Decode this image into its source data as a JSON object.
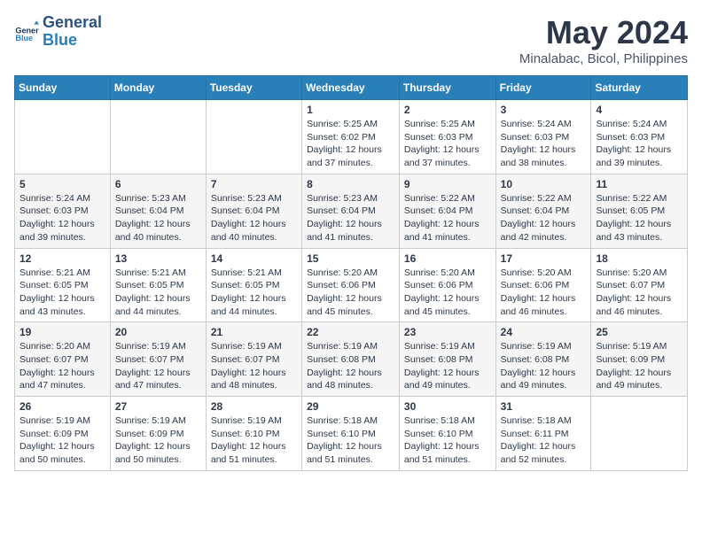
{
  "logo": {
    "text1": "General",
    "text2": "Blue"
  },
  "title": "May 2024",
  "subtitle": "Minalabac, Bicol, Philippines",
  "days_header": [
    "Sunday",
    "Monday",
    "Tuesday",
    "Wednesday",
    "Thursday",
    "Friday",
    "Saturday"
  ],
  "weeks": [
    [
      {
        "day": "",
        "info": ""
      },
      {
        "day": "",
        "info": ""
      },
      {
        "day": "",
        "info": ""
      },
      {
        "day": "1",
        "info": "Sunrise: 5:25 AM\nSunset: 6:02 PM\nDaylight: 12 hours\nand 37 minutes."
      },
      {
        "day": "2",
        "info": "Sunrise: 5:25 AM\nSunset: 6:03 PM\nDaylight: 12 hours\nand 37 minutes."
      },
      {
        "day": "3",
        "info": "Sunrise: 5:24 AM\nSunset: 6:03 PM\nDaylight: 12 hours\nand 38 minutes."
      },
      {
        "day": "4",
        "info": "Sunrise: 5:24 AM\nSunset: 6:03 PM\nDaylight: 12 hours\nand 39 minutes."
      }
    ],
    [
      {
        "day": "5",
        "info": "Sunrise: 5:24 AM\nSunset: 6:03 PM\nDaylight: 12 hours\nand 39 minutes."
      },
      {
        "day": "6",
        "info": "Sunrise: 5:23 AM\nSunset: 6:04 PM\nDaylight: 12 hours\nand 40 minutes."
      },
      {
        "day": "7",
        "info": "Sunrise: 5:23 AM\nSunset: 6:04 PM\nDaylight: 12 hours\nand 40 minutes."
      },
      {
        "day": "8",
        "info": "Sunrise: 5:23 AM\nSunset: 6:04 PM\nDaylight: 12 hours\nand 41 minutes."
      },
      {
        "day": "9",
        "info": "Sunrise: 5:22 AM\nSunset: 6:04 PM\nDaylight: 12 hours\nand 41 minutes."
      },
      {
        "day": "10",
        "info": "Sunrise: 5:22 AM\nSunset: 6:04 PM\nDaylight: 12 hours\nand 42 minutes."
      },
      {
        "day": "11",
        "info": "Sunrise: 5:22 AM\nSunset: 6:05 PM\nDaylight: 12 hours\nand 43 minutes."
      }
    ],
    [
      {
        "day": "12",
        "info": "Sunrise: 5:21 AM\nSunset: 6:05 PM\nDaylight: 12 hours\nand 43 minutes."
      },
      {
        "day": "13",
        "info": "Sunrise: 5:21 AM\nSunset: 6:05 PM\nDaylight: 12 hours\nand 44 minutes."
      },
      {
        "day": "14",
        "info": "Sunrise: 5:21 AM\nSunset: 6:05 PM\nDaylight: 12 hours\nand 44 minutes."
      },
      {
        "day": "15",
        "info": "Sunrise: 5:20 AM\nSunset: 6:06 PM\nDaylight: 12 hours\nand 45 minutes."
      },
      {
        "day": "16",
        "info": "Sunrise: 5:20 AM\nSunset: 6:06 PM\nDaylight: 12 hours\nand 45 minutes."
      },
      {
        "day": "17",
        "info": "Sunrise: 5:20 AM\nSunset: 6:06 PM\nDaylight: 12 hours\nand 46 minutes."
      },
      {
        "day": "18",
        "info": "Sunrise: 5:20 AM\nSunset: 6:07 PM\nDaylight: 12 hours\nand 46 minutes."
      }
    ],
    [
      {
        "day": "19",
        "info": "Sunrise: 5:20 AM\nSunset: 6:07 PM\nDaylight: 12 hours\nand 47 minutes."
      },
      {
        "day": "20",
        "info": "Sunrise: 5:19 AM\nSunset: 6:07 PM\nDaylight: 12 hours\nand 47 minutes."
      },
      {
        "day": "21",
        "info": "Sunrise: 5:19 AM\nSunset: 6:07 PM\nDaylight: 12 hours\nand 48 minutes."
      },
      {
        "day": "22",
        "info": "Sunrise: 5:19 AM\nSunset: 6:08 PM\nDaylight: 12 hours\nand 48 minutes."
      },
      {
        "day": "23",
        "info": "Sunrise: 5:19 AM\nSunset: 6:08 PM\nDaylight: 12 hours\nand 49 minutes."
      },
      {
        "day": "24",
        "info": "Sunrise: 5:19 AM\nSunset: 6:08 PM\nDaylight: 12 hours\nand 49 minutes."
      },
      {
        "day": "25",
        "info": "Sunrise: 5:19 AM\nSunset: 6:09 PM\nDaylight: 12 hours\nand 49 minutes."
      }
    ],
    [
      {
        "day": "26",
        "info": "Sunrise: 5:19 AM\nSunset: 6:09 PM\nDaylight: 12 hours\nand 50 minutes."
      },
      {
        "day": "27",
        "info": "Sunrise: 5:19 AM\nSunset: 6:09 PM\nDaylight: 12 hours\nand 50 minutes."
      },
      {
        "day": "28",
        "info": "Sunrise: 5:19 AM\nSunset: 6:10 PM\nDaylight: 12 hours\nand 51 minutes."
      },
      {
        "day": "29",
        "info": "Sunrise: 5:18 AM\nSunset: 6:10 PM\nDaylight: 12 hours\nand 51 minutes."
      },
      {
        "day": "30",
        "info": "Sunrise: 5:18 AM\nSunset: 6:10 PM\nDaylight: 12 hours\nand 51 minutes."
      },
      {
        "day": "31",
        "info": "Sunrise: 5:18 AM\nSunset: 6:11 PM\nDaylight: 12 hours\nand 52 minutes."
      },
      {
        "day": "",
        "info": ""
      }
    ]
  ]
}
